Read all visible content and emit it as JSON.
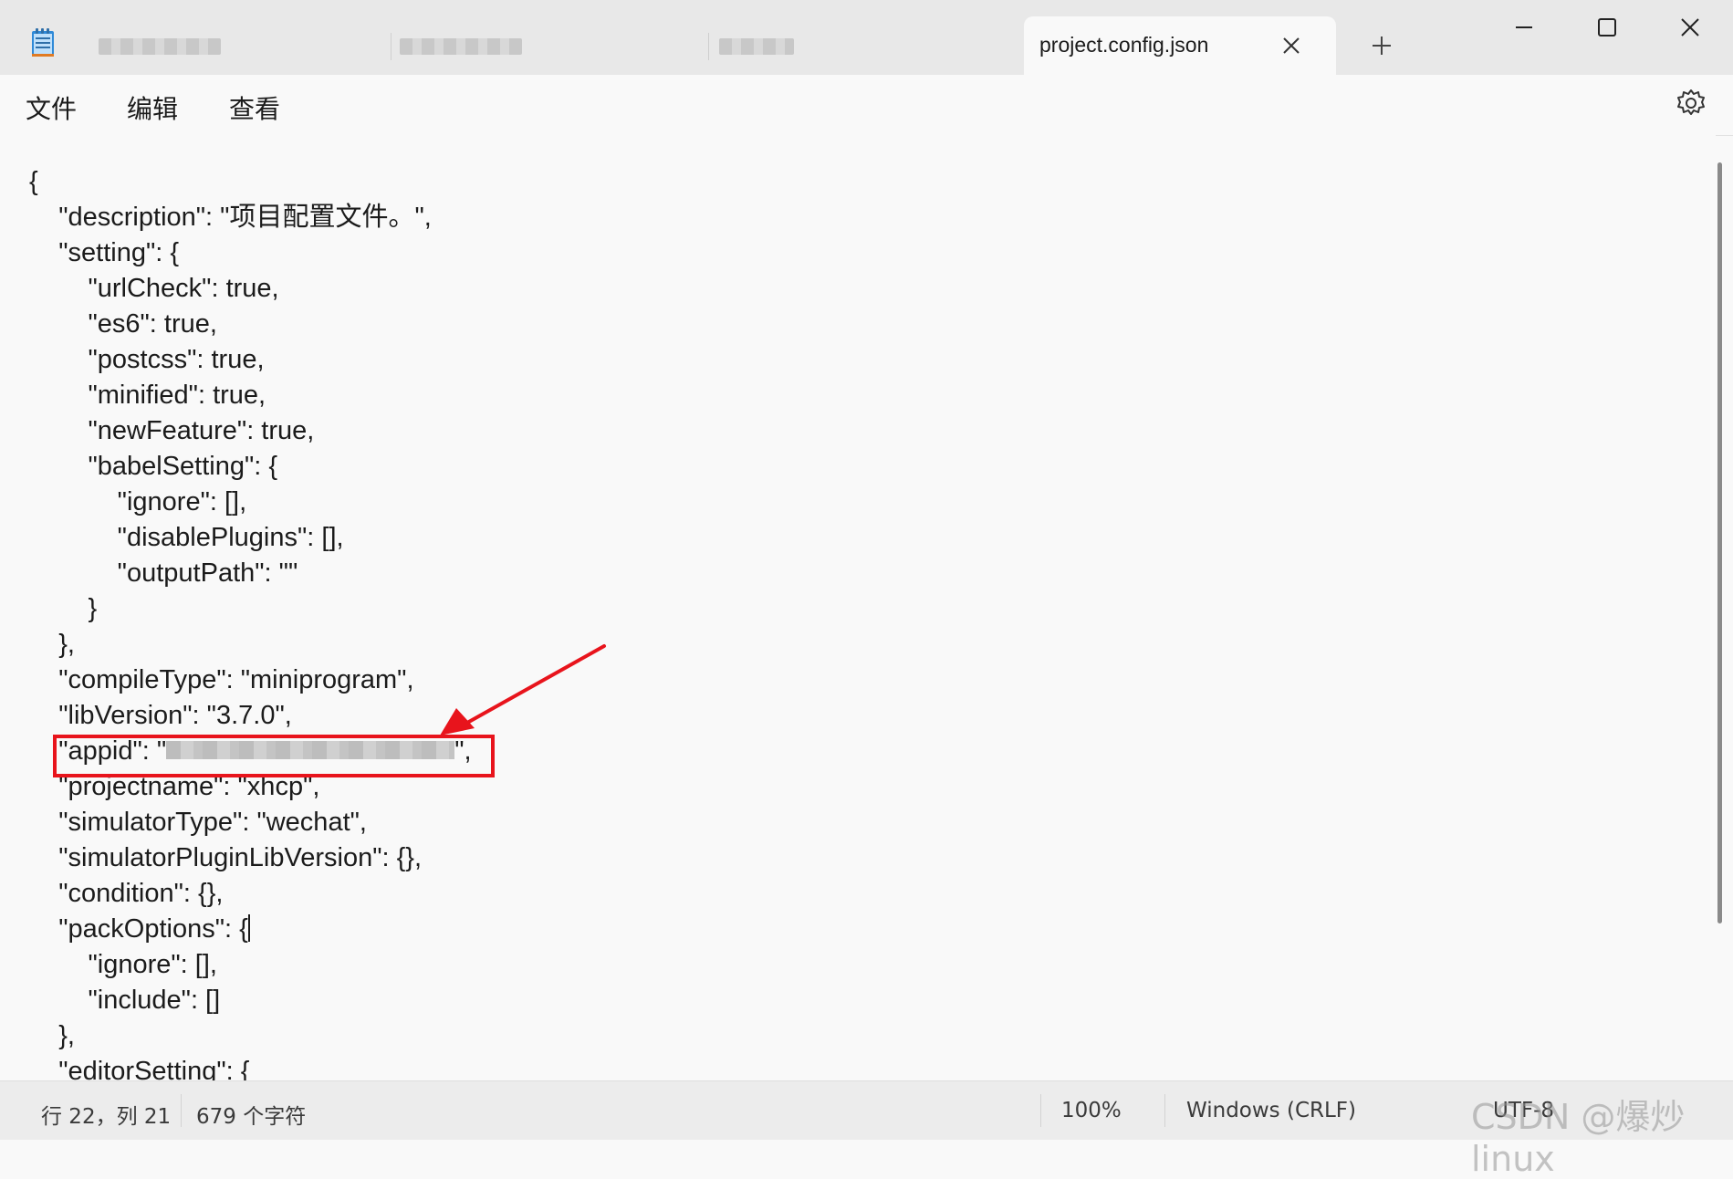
{
  "window": {
    "active_tab_title": "project.config.json",
    "new_tab_symbol": "+",
    "controls": [
      "minimize-icon",
      "maximize-icon",
      "close-icon"
    ]
  },
  "menu": {
    "file": "文件",
    "edit": "编辑",
    "view": "查看"
  },
  "editor": {
    "lines": [
      "{",
      "    \"description\": \"项目配置文件。\",",
      "    \"setting\": {",
      "        \"urlCheck\": true,",
      "        \"es6\": true,",
      "        \"postcss\": true,",
      "        \"minified\": true,",
      "        \"newFeature\": true,",
      "        \"babelSetting\": {",
      "            \"ignore\": [],",
      "            \"disablePlugins\": [],",
      "            \"outputPath\": \"\"",
      "        }",
      "    },",
      "    \"compileType\": \"miniprogram\",",
      "    \"libVersion\": \"3.7.0\",",
      "    \"appid\": \"",
      "    \"projectname\": \"xhcp\",",
      "    \"simulatorType\": \"wechat\",",
      "    \"simulatorPluginLibVersion\": {},",
      "    \"condition\": {},",
      "    \"packOptions\": {",
      "        \"ignore\": [],",
      "        \"include\": []",
      "    },",
      "    \"editorSetting\": {"
    ],
    "appid_suffix": "\","
  },
  "status": {
    "position": "行 22，列 21",
    "char_count": "679 个字符",
    "zoom": "100%",
    "line_ending": "Windows (CRLF)",
    "encoding": "UTF-8"
  },
  "watermark": "CSDN @爆炒linux",
  "colors": {
    "highlight": "#e8141c",
    "titlebar": "#e8e8e8",
    "editor_bg": "#f9f9f9"
  }
}
